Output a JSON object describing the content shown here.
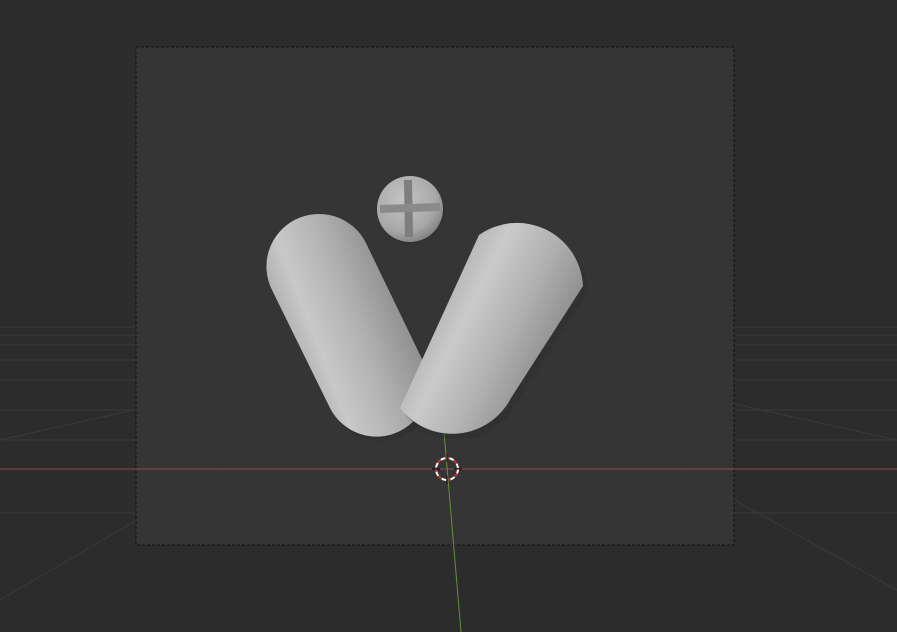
{
  "viewport": {
    "background": "#2c2c2c",
    "camera_frame_fill": "#383838",
    "grid_color": "#3a3a3a",
    "x_axis_color": "#b04a50",
    "y_axis_color": "#6a9a3a",
    "object_color": "#b4b4b4"
  },
  "scene_objects": [
    {
      "name": "capsule-small",
      "type": "capsule"
    },
    {
      "name": "capsule-large",
      "type": "capsule"
    },
    {
      "name": "pill-tablet",
      "type": "tablet",
      "marking": "cross-score"
    }
  ],
  "overlays": {
    "camera_frame": "dashed",
    "cursor_3d": "3d-cursor-icon"
  }
}
